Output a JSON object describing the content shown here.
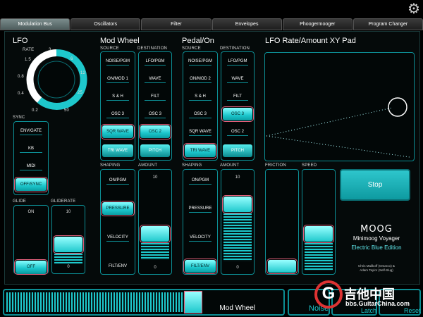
{
  "tabs": [
    {
      "label": "Modulation Bus",
      "active": true
    },
    {
      "label": "Oscillators",
      "active": false
    },
    {
      "label": "Filter",
      "active": false
    },
    {
      "label": "Envelopes",
      "active": false
    },
    {
      "label": "Phoogermooger",
      "active": false
    },
    {
      "label": "Program Changer",
      "active": false
    }
  ],
  "lfo": {
    "title": "LFO",
    "rate_label": "RATE",
    "scale": [
      "0.2",
      "0.4",
      "0.8",
      "1.5",
      "3",
      "6",
      "12",
      "25",
      "50"
    ],
    "sync_label": "SYNC",
    "sync_options": [
      "ENV/GATE",
      "KB",
      "MIDI",
      "OFF/SYNC"
    ],
    "sync_selected": "OFF/SYNC",
    "glide_label": "GLIDE",
    "glide_top": "ON",
    "glide_bottom": "OFF",
    "gliderate_label": "GLIDERATE",
    "gliderate_top": "10",
    "gliderate_bottom": "0"
  },
  "modwheel": {
    "title": "Mod Wheel",
    "source_label": "SOURCE",
    "destination_label": "DESTINATION",
    "sources": [
      "NOISE/PGM",
      "ON/MOD 1",
      "S & H",
      "OSC 3",
      "SQR WAVE",
      "TRI WAVE"
    ],
    "source_selected": "SQR WAVE",
    "destinations": [
      "LFO/PGM",
      "WAVE",
      "FILT",
      "OSC 3",
      "OSC 2",
      "PITCH"
    ],
    "destination_selected": "OSC 2",
    "shaping_label": "SHAPING",
    "amount_label": "AMOUNT",
    "shapings": [
      "ON/PGM",
      "PRESSURE",
      "VELOCITY",
      "FILT/ENV"
    ],
    "shaping_selected": "PRESSURE",
    "amount_top": "10",
    "amount_bottom": "0"
  },
  "pedal": {
    "title": "Pedal/On",
    "source_label": "SOURCE",
    "destination_label": "DESTINATION",
    "sources": [
      "NOISE/PGM",
      "ON/MOD 2",
      "S & H",
      "OSC 3",
      "SQR WAVE",
      "TRI WAVE"
    ],
    "source_selected": "TRI WAVE",
    "destinations": [
      "LFO/PGM",
      "WAVE",
      "FILT",
      "OSC 3",
      "OSC 2",
      "PITCH"
    ],
    "destination_selected": "OSC 3",
    "shaping_label": "SHAPING",
    "amount_label": "AMOUNT",
    "shapings": [
      "ON/PGM",
      "PRESSURE",
      "VELOCITY",
      "FILT/ENV"
    ],
    "shaping_selected": "FILT/ENV",
    "amount_top": "10",
    "amount_bottom": "0"
  },
  "xy": {
    "title": "LFO Rate/Amount XY Pad",
    "friction_label": "FRICTION",
    "speed_label": "SPEED",
    "stop_label": "Stop"
  },
  "brand": {
    "logo": "MOOG",
    "model": "Minimoog Voyager",
    "edition": "Electric Blue Edition",
    "credits_1": "Chris Malikoff (Omaroo) &",
    "credits_2": "Adam Taylor (Self-Slug)"
  },
  "bottom": {
    "modwheel_label": "Mod Wheel",
    "noise_label": "Noise",
    "latch_label": "Latch",
    "reset_label": "Reset",
    "watermark_1": "吉他中国",
    "watermark_2": "bbs.GuitarChina.com"
  },
  "colors": {
    "accent": "#1ec8cc",
    "outline": "#0c8e94",
    "selected_outline": "#e35f7a"
  }
}
